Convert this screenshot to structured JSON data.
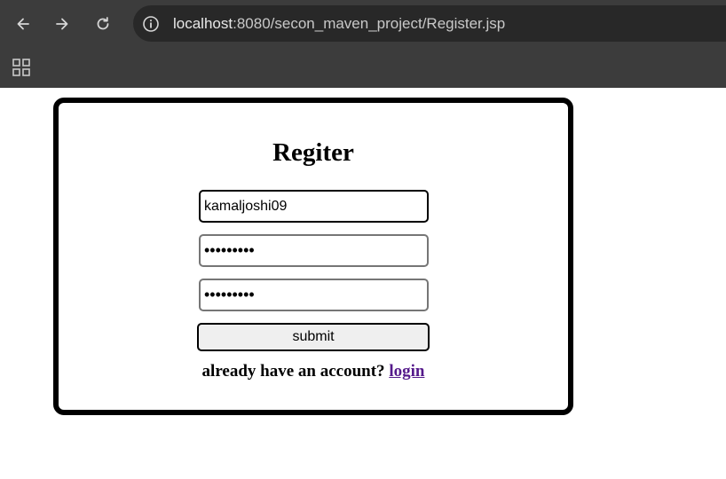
{
  "browser": {
    "url_host": "localhost",
    "url_rest": ":8080/secon_maven_project/Register.jsp",
    "icons": {
      "back": "back-arrow-icon",
      "forward": "forward-arrow-icon",
      "reload": "reload-icon",
      "info": "site-info-icon",
      "apps": "apps-grid-icon"
    }
  },
  "form": {
    "title": "Regiter",
    "username_value": "kamaljoshi09",
    "password_value": "•••••••••",
    "confirm_value": "•••••••••",
    "submit_label": "submit",
    "footer_text": "already have an account? ",
    "login_link": "login"
  },
  "colors": {
    "chrome_bg": "#3c3c3c",
    "omnibox_bg": "#282828",
    "link_visited": "#551a8b"
  }
}
